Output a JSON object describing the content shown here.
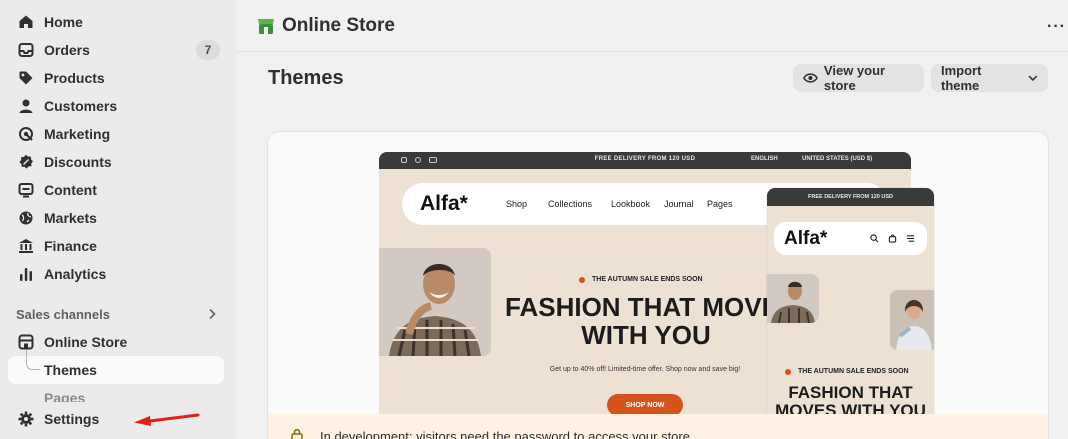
{
  "sidebar": {
    "items": [
      {
        "label": "Home",
        "icon": "home-icon"
      },
      {
        "label": "Orders",
        "icon": "orders-icon",
        "badge": "7"
      },
      {
        "label": "Products",
        "icon": "tag-icon"
      },
      {
        "label": "Customers",
        "icon": "person-icon"
      },
      {
        "label": "Marketing",
        "icon": "target-icon"
      },
      {
        "label": "Discounts",
        "icon": "discount-icon"
      },
      {
        "label": "Content",
        "icon": "content-icon"
      },
      {
        "label": "Markets",
        "icon": "globe-icon"
      },
      {
        "label": "Finance",
        "icon": "bank-icon"
      },
      {
        "label": "Analytics",
        "icon": "bar-chart-icon"
      }
    ],
    "sales_channels_label": "Sales channels",
    "online_store_label": "Online Store",
    "themes_label": "Themes",
    "pages_label": "Pages",
    "settings_label": "Settings"
  },
  "header": {
    "title": "Online Store",
    "more": "···"
  },
  "main": {
    "page_title": "Themes",
    "view_store_label": "View your store",
    "import_theme_label": "Import theme"
  },
  "preview": {
    "promo": "FREE DELIVERY FROM 120 USD",
    "language": "ENGLISH",
    "currency": "UNITED STATES (USD $)",
    "logo": "Alfa*",
    "menu": [
      "Shop",
      "Collections",
      "Lookbook",
      "Journal",
      "Pages"
    ],
    "sale_text": "THE AUTUMN SALE ENDS SOON",
    "headline_line1": "FASHION THAT MOVES",
    "headline_line2": "WITH YOU",
    "subtext": "Get up to 40% off! Limited-time offer. Shop now and save big!",
    "cta": "SHOP NOW",
    "mobile_headline_line1": "FASHION THAT",
    "mobile_headline_line2": "MOVES WITH YOU"
  },
  "banner": {
    "text": "In development: visitors need the password to access your store"
  },
  "colors": {
    "accent": "#d4541c",
    "annotation_arrow": "#e0201a",
    "store_icon": "#3f8f3a"
  }
}
